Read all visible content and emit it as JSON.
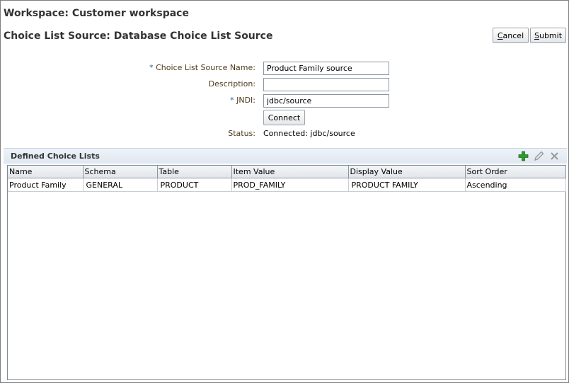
{
  "workspace": {
    "title": "Workspace: Customer workspace"
  },
  "page": {
    "title": "Choice List Source: Database Choice List Source"
  },
  "actions": {
    "cancel_label": "Cancel",
    "submit_label": "Submit"
  },
  "form": {
    "name_label": "Choice List Source Name:",
    "name_value": "Product Family source",
    "description_label": "Description:",
    "description_value": "",
    "jndi_label": "JNDI:",
    "jndi_value": "jdbc/source",
    "required_marker": "*",
    "connect_label": "Connect",
    "status_label": "Status:",
    "status_value": "Connected: jdbc/source"
  },
  "panel": {
    "title": "Defined Choice Lists",
    "toolbar": {
      "add_icon": "add-icon",
      "edit_icon": "edit-icon",
      "delete_icon": "delete-icon"
    }
  },
  "table": {
    "columns": [
      "Name",
      "Schema",
      "Table",
      "Item Value",
      "Display Value",
      "Sort Order"
    ],
    "rows": [
      [
        "Product Family",
        "GENERAL",
        "PRODUCT",
        "PROD_FAMILY",
        "PRODUCT FAMILY",
        "Ascending"
      ]
    ]
  },
  "colors": {
    "add_icon": "#2e9a2e",
    "header_bg": "#dfe7ef",
    "label_text": "#4d3a1a",
    "required_marker": "#2a5aa8"
  }
}
